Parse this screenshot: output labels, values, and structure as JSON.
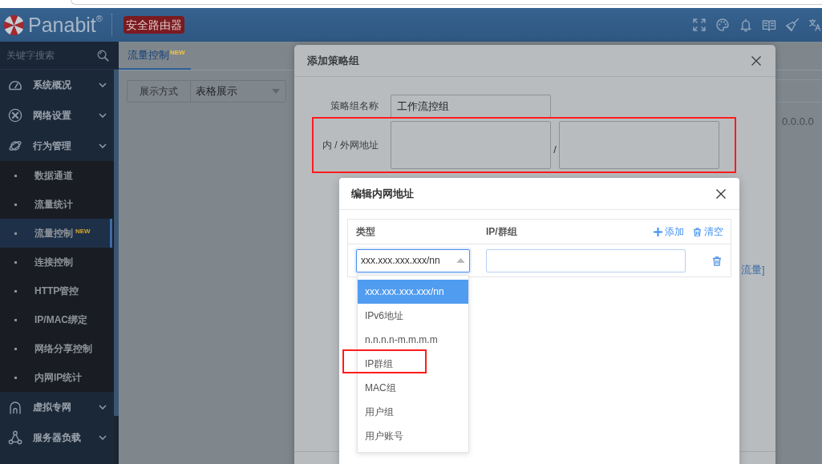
{
  "header": {
    "logo": "Panabit",
    "logo_mark": "®",
    "badge": "安全路由器"
  },
  "sidebar": {
    "search": {
      "placeholder": "关键字搜索"
    },
    "items": [
      {
        "label": "系统概况"
      },
      {
        "label": "网络设置"
      },
      {
        "label": "行为管理",
        "children": [
          {
            "label": "数据通道",
            "selected": false
          },
          {
            "label": "流量统计",
            "selected": false
          },
          {
            "label": "流量控制",
            "badge": "NEW",
            "selected": true
          },
          {
            "label": "连接控制",
            "selected": false
          },
          {
            "label": "HTTP管控",
            "selected": false
          },
          {
            "label": "IP/MAC绑定",
            "selected": false
          },
          {
            "label": "网络分享控制",
            "selected": false
          },
          {
            "label": "内网IP统计",
            "selected": false
          }
        ]
      },
      {
        "label": "虚拟专网"
      },
      {
        "label": "服务器负载"
      }
    ]
  },
  "tabs": [
    {
      "label": "流量控制",
      "badge": "NEW",
      "selected": true
    }
  ],
  "toolbar": {
    "display_mode": {
      "label": "展示方式",
      "value": "表格展示"
    }
  },
  "table": {
    "cell": "0.0.0.0"
  },
  "policy_dialog": {
    "title": "添加策略组",
    "fields": [
      {
        "kind": "text",
        "label": "策略组名称",
        "value": "工作流控组",
        "highlighted": false
      },
      {
        "kind": "pair",
        "label": "内 / 外网地址",
        "separator": "/",
        "highlighted": true
      }
    ],
    "link": "流量]"
  },
  "address_dialog": {
    "title": "编辑内网地址",
    "columns": [
      "类型",
      "IP/群组"
    ],
    "actions": [
      {
        "kind": "add",
        "label": "添加"
      },
      {
        "kind": "clear",
        "label": "清空"
      }
    ],
    "rows": [
      {
        "type": "xxx.xxx.xxx.xxx/nn",
        "open": true,
        "options": [
          {
            "label": "xxx.xxx.xxx.xxx/nn",
            "selected": true,
            "highlighted": false
          },
          {
            "label": "IPv6地址",
            "selected": false,
            "highlighted": false
          },
          {
            "label": "n.n.n.n-m.m.m.m",
            "selected": false,
            "highlighted": false
          },
          {
            "label": "IP群组",
            "selected": false,
            "highlighted": true
          },
          {
            "label": "MAC组",
            "selected": false,
            "highlighted": false
          },
          {
            "label": "用户组",
            "selected": false,
            "highlighted": false
          },
          {
            "label": "用户账号",
            "selected": false,
            "highlighted": false
          }
        ]
      }
    ]
  }
}
